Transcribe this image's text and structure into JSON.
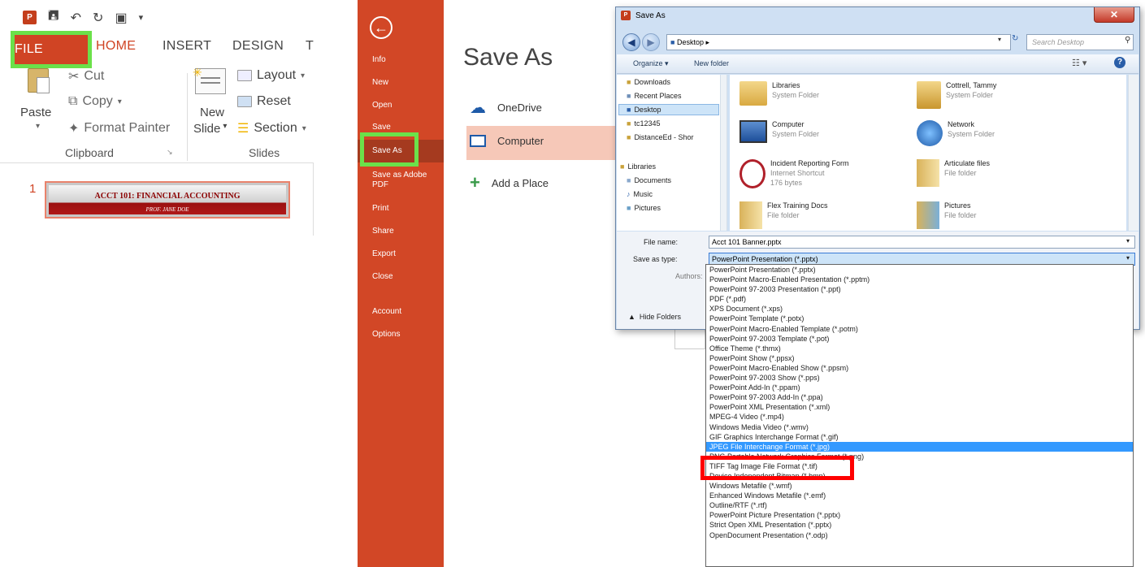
{
  "ribbon": {
    "qat_logo": "P",
    "tabs": [
      "FILE",
      "HOME",
      "INSERT",
      "DESIGN",
      "T"
    ],
    "clipboard": {
      "paste": "Paste",
      "cut": "Cut",
      "copy": "Copy",
      "format_painter": "Format Painter",
      "label": "Clipboard"
    },
    "slides": {
      "new_slide_1": "New",
      "new_slide_2": "Slide",
      "layout": "Layout",
      "reset": "Reset",
      "section": "Section",
      "label": "Slides"
    },
    "slide_number": "1",
    "banner_title": "ACCT 101: FINANCIAL ACCOUNTING",
    "banner_sub": "PROF. JANE DOE"
  },
  "backstage": {
    "items": [
      "Info",
      "New",
      "Open",
      "Save",
      "Save As",
      "Save as Adobe PDF",
      "Print",
      "Share",
      "Export",
      "Close",
      "Account",
      "Options"
    ],
    "colors": {
      "bg": "#d24726",
      "selected": "#a53a1f",
      "highlight": "#6be14a"
    }
  },
  "saveas": {
    "title": "Save As",
    "places": [
      "OneDrive",
      "Computer",
      "Add a Place"
    ]
  },
  "dialog": {
    "title": "Save As",
    "address": "Desktop",
    "search_placeholder": "Search Desktop",
    "organize": "Organize",
    "new_folder": "New folder",
    "tree": [
      "Downloads",
      "Recent Places",
      "Desktop",
      "tc12345",
      "DistanceEd - Shor",
      "Libraries",
      "Documents",
      "Music",
      "Pictures"
    ],
    "files": [
      {
        "name": "Libraries",
        "sub": "System Folder",
        "icon": "library-icon"
      },
      {
        "name": "Cottrell, Tammy",
        "sub": "System Folder",
        "icon": "user-folder-icon"
      },
      {
        "name": "Computer",
        "sub": "System Folder",
        "icon": "computer-icon"
      },
      {
        "name": "Network",
        "sub": "System Folder",
        "icon": "network-icon"
      },
      {
        "name": "Incident Reporting Form",
        "sub": "Internet Shortcut",
        "sub2": "176 bytes",
        "icon": "shortcut-icon"
      },
      {
        "name": "Articulate files",
        "sub": "File folder",
        "icon": "folder-icon"
      },
      {
        "name": "Flex Training Docs",
        "sub": "File folder",
        "icon": "folder-icon"
      },
      {
        "name": "Pictures",
        "sub": "File folder",
        "icon": "folder-icon"
      }
    ],
    "file_name_label": "File name:",
    "file_name_value": "Acct 101 Banner.pptx",
    "save_type_label": "Save as type:",
    "save_type_value": "PowerPoint Presentation (*.pptx)",
    "authors_label": "Authors:",
    "hide_folders": "Hide Folders"
  },
  "dropdown": {
    "options": [
      "PowerPoint Presentation (*.pptx)",
      "PowerPoint Macro-Enabled Presentation (*.pptm)",
      "PowerPoint 97-2003 Presentation (*.ppt)",
      "PDF (*.pdf)",
      "XPS Document (*.xps)",
      "PowerPoint Template (*.potx)",
      "PowerPoint Macro-Enabled Template (*.potm)",
      "PowerPoint 97-2003 Template (*.pot)",
      "Office Theme (*.thmx)",
      "PowerPoint Show (*.ppsx)",
      "PowerPoint Macro-Enabled Show (*.ppsm)",
      "PowerPoint 97-2003 Show (*.pps)",
      "PowerPoint Add-In (*.ppam)",
      "PowerPoint 97-2003 Add-In (*.ppa)",
      "PowerPoint XML Presentation (*.xml)",
      "MPEG-4 Video (*.mp4)",
      "Windows Media Video (*.wmv)",
      "GIF Graphics Interchange Format (*.gif)",
      "JPEG File Interchange Format (*.jpg)",
      "PNG Portable Network Graphics Format (*.png)",
      "TIFF Tag Image File Format (*.tif)",
      "Device Independent Bitmap (*.bmp)",
      "Windows Metafile (*.wmf)",
      "Enhanced Windows Metafile (*.emf)",
      "Outline/RTF (*.rtf)",
      "PowerPoint Picture Presentation (*.pptx)",
      "Strict Open XML Presentation (*.pptx)",
      "OpenDocument Presentation (*.odp)"
    ],
    "highlighted_index": 18,
    "highlight_color": "#3399ff",
    "callout_color": "#ff0000"
  }
}
